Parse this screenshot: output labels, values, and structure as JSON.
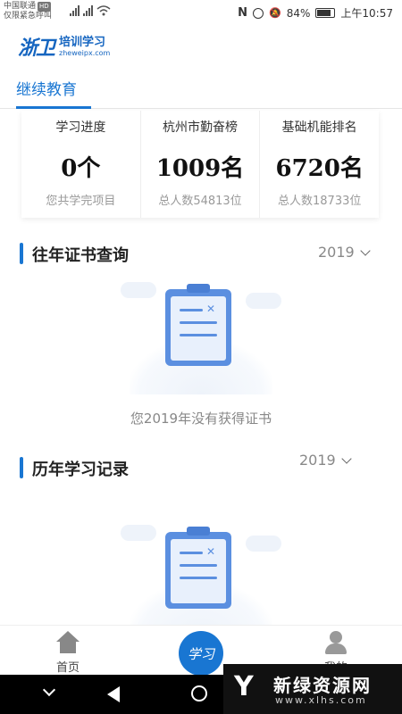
{
  "status_bar": {
    "carrier": "中国联通",
    "carrier_badge": "HD",
    "carrier_sub": "仅限紧急呼叫",
    "battery": "84%",
    "time": "上午10:57"
  },
  "header": {
    "logo_mark": "浙卫",
    "title": "培训学习",
    "url": "zheweipx.com"
  },
  "tabs": [
    {
      "label": "继续教育",
      "active": true
    }
  ],
  "stats": [
    {
      "label": "学习进度",
      "value": "0个",
      "sub": "您共学完项目"
    },
    {
      "label": "杭州市勤奋榜",
      "value": "1009名",
      "sub": "总人数54813位"
    },
    {
      "label": "基础机能排名",
      "value": "6720名",
      "sub": "总人数18733位"
    }
  ],
  "sections": {
    "certificates": {
      "title": "往年证书查询",
      "year": "2019",
      "empty_text": "您2019年没有获得证书"
    },
    "records": {
      "title": "历年学习记录",
      "year": "2019"
    }
  },
  "bottom_nav": {
    "home": "首页",
    "study": "学习",
    "mine": "我的"
  },
  "watermark": {
    "title": "新绿资源网",
    "url": "www.xlhs.com"
  },
  "colors": {
    "accent": "#1976d2",
    "illustration": "#5b8fe0"
  }
}
